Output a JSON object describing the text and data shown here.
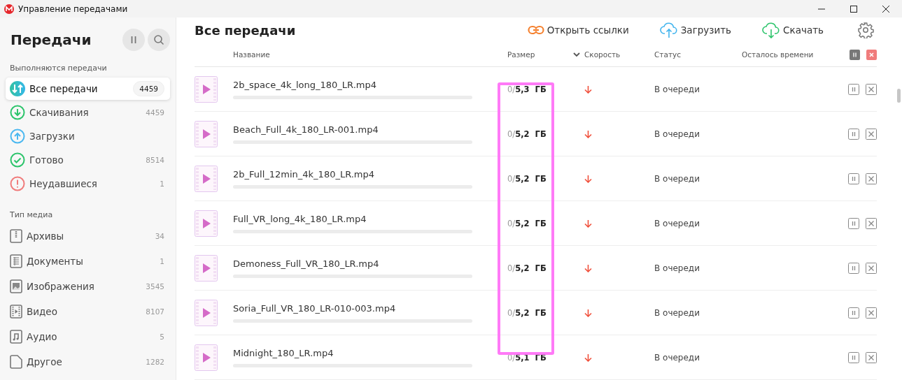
{
  "window": {
    "title": "Управление передачами"
  },
  "sidebar": {
    "title": "Передачи",
    "sections": [
      {
        "heading": "Выполняются передачи",
        "items": [
          {
            "kind": "all",
            "label": "Все передачи",
            "count": "4459",
            "selected": true
          },
          {
            "kind": "download",
            "label": "Скачивания",
            "count": "4459",
            "selected": false
          },
          {
            "kind": "upload",
            "label": "Загрузки",
            "selected": false
          },
          {
            "kind": "done",
            "label": "Готово",
            "count": "8514",
            "selected": false
          },
          {
            "kind": "failed",
            "label": "Неудавшиеся",
            "count": "1",
            "selected": false
          }
        ]
      },
      {
        "heading": "Тип медиа",
        "items": [
          {
            "kind": "archive",
            "label": "Архивы",
            "count": "34",
            "selected": false
          },
          {
            "kind": "document",
            "label": "Документы",
            "count": "1",
            "selected": false
          },
          {
            "kind": "image",
            "label": "Изображения",
            "count": "3545",
            "selected": false
          },
          {
            "kind": "video",
            "label": "Видео",
            "count": "8107",
            "selected": false
          },
          {
            "kind": "audio",
            "label": "Аудио",
            "count": "5",
            "selected": false
          },
          {
            "kind": "other",
            "label": "Другое",
            "count": "1282",
            "selected": false
          }
        ]
      }
    ]
  },
  "main": {
    "title": "Все передачи",
    "actions": [
      {
        "kind": "link",
        "label": "Открыть ссылки"
      },
      {
        "kind": "upload",
        "label": "Загрузить"
      },
      {
        "kind": "download",
        "label": "Скачать"
      }
    ],
    "table": {
      "columns": [
        "Название",
        "Размер",
        "Скорость",
        "Статус",
        "Осталось времени"
      ],
      "rows": [
        {
          "name": "2b_space_4k_long_180_LR.mp4",
          "level": 0,
          "size_done": "0/",
          "size_total": "5,3  ГБ",
          "status": "В очереди"
        },
        {
          "name": "Beach_Full_4k_180_LR-001.mp4",
          "level": 0,
          "size_done": "0/",
          "size_total": "5,2  ГБ",
          "status": "В очереди"
        },
        {
          "name": "2b_Full_12min_4k_180_LR.mp4",
          "level": 0,
          "size_done": "0/",
          "size_total": "5,2  ГБ",
          "status": "В очереди"
        },
        {
          "name": "Full_VR_long_4k_180_LR.mp4",
          "level": 0,
          "size_done": "0/",
          "size_total": "5,2  ГБ",
          "status": "В очереди"
        },
        {
          "name": "Demoness_Full_VR_180_LR.mp4",
          "level": 0,
          "size_done": "0/",
          "size_total": "5,2  ГБ",
          "status": "В очереди"
        },
        {
          "name": "Soria_Full_VR_180_LR-010-003.mp4",
          "level": 0,
          "size_done": "0/",
          "size_total": "5,2  ГБ",
          "status": "В очереди"
        },
        {
          "name": "Midnight_180_LR.mp4",
          "level": 0,
          "size_done": "0/",
          "size_total": "5,1  ГБ",
          "status": "В очереди"
        }
      ]
    }
  }
}
